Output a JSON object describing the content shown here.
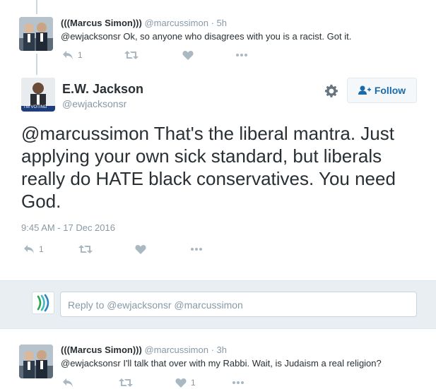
{
  "tweet_top": {
    "display_name": "(((Marcus Simon)))",
    "handle": "@marcussimon",
    "time": "· 5h",
    "text": "@ewjacksonsr Ok, so anyone who disagrees with you is a racist. Got it.",
    "reply_count": "1",
    "retweet_count": "",
    "like_count": ""
  },
  "main_tweet": {
    "display_name": "E.W. Jackson",
    "handle": "@ewjacksonsr",
    "avatar_badge": "I'M VOTING",
    "follow_label": "Follow",
    "text": "@marcussimon That's the liberal mantra. Just applying your own sick standard, but liberals really do HATE black conservatives. You need God.",
    "timestamp": "9:45 AM - 17 Dec 2016",
    "reply_count": "1",
    "retweet_count": "",
    "like_count": ""
  },
  "reply_box": {
    "placeholder": "Reply to @ewjacksonsr @marcussimon"
  },
  "tweet_bottom": {
    "display_name": "(((Marcus Simon)))",
    "handle": "@marcussimon",
    "time": "· 3h",
    "text": "@ewjacksonsr I'll talk that over with my Rabbi.  Wait, is Judaism a real religion?",
    "reply_count": "",
    "retweet_count": "",
    "like_count": "1"
  },
  "colors": {
    "text": "#292f33",
    "secondary": "#8899a6",
    "icon": "#aab8c2",
    "link_blue": "#1b6baa",
    "reply_bar_bg": "#e8eef2"
  },
  "icons": {
    "reply": "reply-icon",
    "retweet": "retweet-icon",
    "like": "heart-icon",
    "more": "more-icon",
    "settings": "gear-icon",
    "follow": "add-user-icon"
  }
}
